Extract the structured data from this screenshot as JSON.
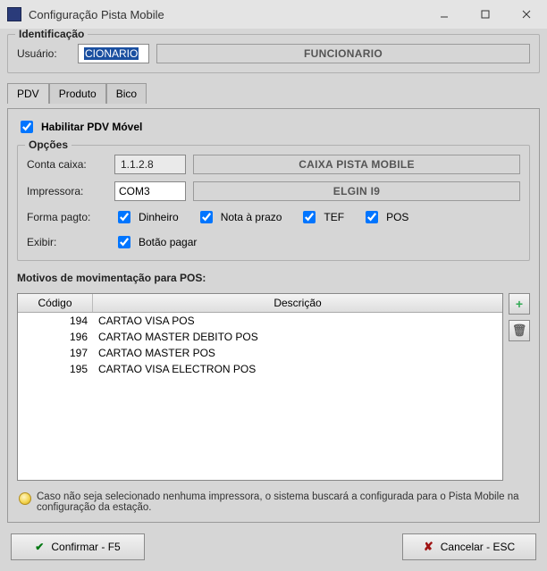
{
  "window": {
    "title": "Configuração Pista Mobile"
  },
  "ident": {
    "legend": "Identificação",
    "usuario_label": "Usuário:",
    "usuario_value": "CIONARIO",
    "usuario_display": "FUNCIONARIO"
  },
  "tabs": {
    "pdv": "PDV",
    "produto": "Produto",
    "bico": "Bico",
    "active": "pdv"
  },
  "pdv": {
    "enable_label": "Habilitar PDV Móvel",
    "enable_checked": true,
    "options": {
      "legend": "Opções",
      "conta_label": "Conta caixa:",
      "conta_value": "1.1.2.8",
      "conta_display": "CAIXA PISTA MOBILE",
      "impressora_label": "Impressora:",
      "impressora_value": "COM3",
      "impressora_display": "ELGIN I9",
      "formapg_label": "Forma pagto:",
      "pay": {
        "dinheiro": {
          "label": "Dinheiro",
          "checked": true
        },
        "nota": {
          "label": "Nota à prazo",
          "checked": true
        },
        "tef": {
          "label": "TEF",
          "checked": true
        },
        "pos": {
          "label": "POS",
          "checked": true
        }
      },
      "exibir_label": "Exibir:",
      "botao_pagar": {
        "label": "Botão pagar",
        "checked": true
      }
    },
    "motives": {
      "title": "Motivos de movimentação para POS:",
      "col_codigo": "Código",
      "col_desc": "Descrição",
      "rows": [
        {
          "codigo": "194",
          "desc": "CARTAO VISA POS"
        },
        {
          "codigo": "196",
          "desc": "CARTAO MASTER DEBITO POS"
        },
        {
          "codigo": "197",
          "desc": "CARTAO MASTER POS"
        },
        {
          "codigo": "195",
          "desc": "CARTAO VISA ELECTRON POS"
        }
      ]
    },
    "hint": "Caso não seja selecionado nenhuma impressora, o sistema buscará a configurada para o Pista Mobile na configuração da estação."
  },
  "footer": {
    "confirm": "Confirmar - F5",
    "cancel": "Cancelar - ESC"
  }
}
